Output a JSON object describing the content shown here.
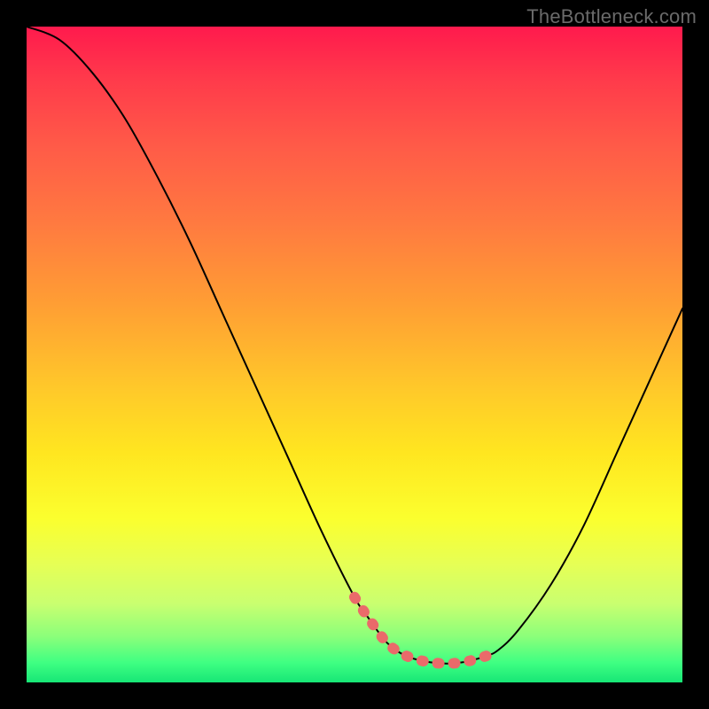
{
  "watermark": "TheBottleneck.com",
  "chart_data": {
    "type": "line",
    "title": "",
    "xlabel": "",
    "ylabel": "",
    "xlim": [
      0,
      100
    ],
    "ylim": [
      0,
      100
    ],
    "grid": false,
    "legend": null,
    "series": [
      {
        "name": "bottleneck-curve",
        "color": "#000000",
        "stroke_width": 2,
        "x": [
          0,
          5,
          10,
          15,
          20,
          25,
          30,
          35,
          40,
          45,
          50,
          52,
          55,
          58,
          62,
          66,
          70,
          72,
          75,
          80,
          85,
          90,
          95,
          100
        ],
        "values": [
          100,
          98,
          93,
          86,
          77,
          67,
          56,
          45,
          34,
          23,
          13,
          10,
          6,
          4,
          3,
          3,
          4,
          5,
          8,
          15,
          24,
          35,
          46,
          57
        ]
      },
      {
        "name": "highlight-zone",
        "color": "#ea6a6a",
        "stroke_width": 12,
        "x": [
          50,
          52,
          55,
          58,
          62,
          66,
          70,
          72
        ],
        "values": [
          13,
          10,
          6,
          4,
          3,
          3,
          4,
          5
        ]
      }
    ],
    "background_gradient": {
      "direction": "vertical",
      "stops": [
        {
          "pos": 0,
          "color": "#ff1a4d"
        },
        {
          "pos": 30,
          "color": "#ff7a40"
        },
        {
          "pos": 55,
          "color": "#ffc82a"
        },
        {
          "pos": 75,
          "color": "#fbff2e"
        },
        {
          "pos": 93,
          "color": "#8bff7a"
        },
        {
          "pos": 100,
          "color": "#17e676"
        }
      ]
    }
  }
}
